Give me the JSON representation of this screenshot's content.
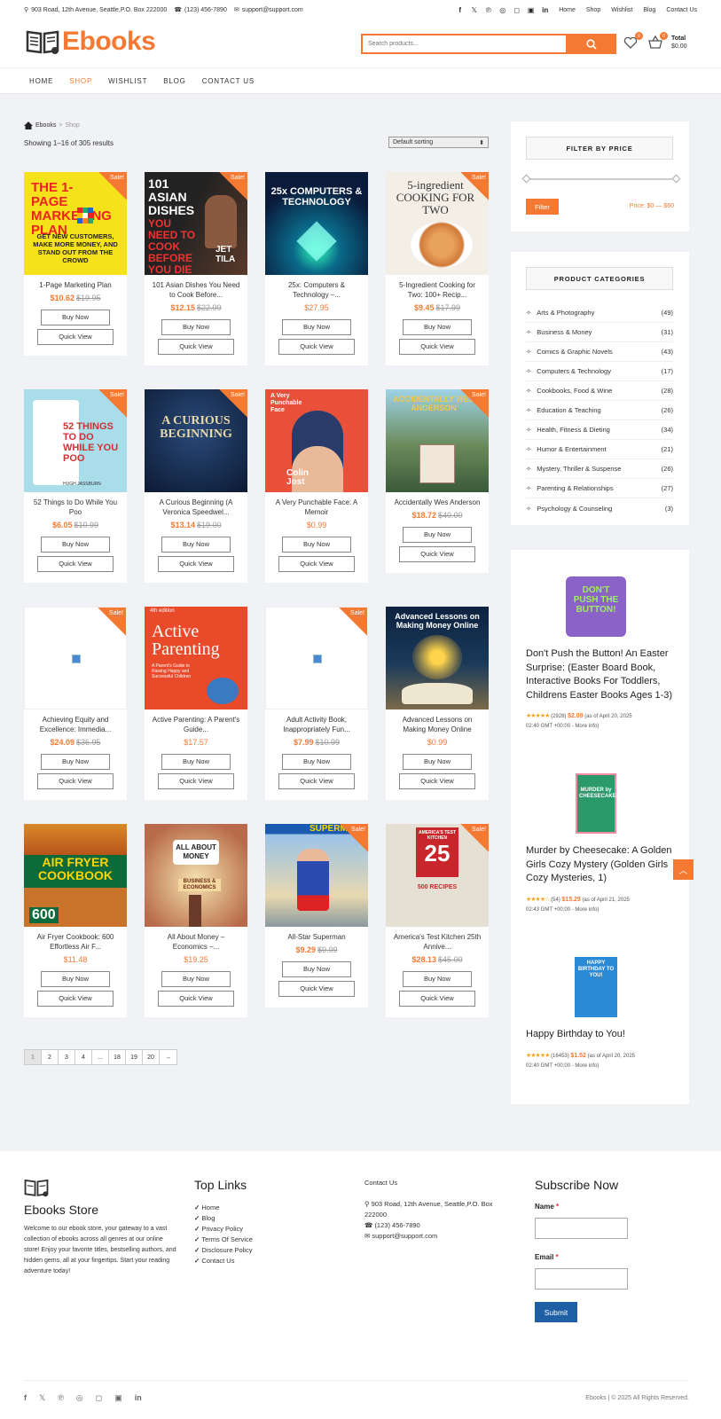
{
  "topbar": {
    "address": "903  Road, 12th Avenue, Seattle,P.O. Box 222000",
    "phone": "(123) 456-7890",
    "email": "support@support.com",
    "social_icons": [
      "facebook-icon",
      "x-icon",
      "pinterest-icon",
      "dribbble-icon",
      "instagram-icon",
      "flickr-icon",
      "linkedin-icon"
    ],
    "links": [
      "Home",
      "Shop",
      "Wishlist",
      "Blog",
      "Contact Us"
    ]
  },
  "header": {
    "logo_text": "Ebooks",
    "search_placeholder": "Search products...",
    "wishlist_count": "0",
    "cart_count": "0",
    "total_label": "Total",
    "total_value": "$0.00"
  },
  "nav": [
    "HOME",
    "SHOP",
    "WISHLIST",
    "BLOG",
    "CONTACT US"
  ],
  "breadcrumb": {
    "home": "Ebooks",
    "sep": ">",
    "current": "Shop"
  },
  "results_text": "Showing 1–16 of 305 results",
  "sort_selected": "Default sorting",
  "products": [
    {
      "title": "1-Page Marketing Plan",
      "price": "$10.62",
      "old": "$19.95",
      "sale": true
    },
    {
      "title": "101 Asian Dishes You Need to Cook Before...",
      "price": "$12.15",
      "old": "$22.99",
      "sale": true
    },
    {
      "title": "25x: Computers & Technology –...",
      "price": "$27.95",
      "old": "",
      "sale": false
    },
    {
      "title": "5-Ingredient Cooking for Two: 100+ Recip...",
      "price": "$9.45",
      "old": "$17.99",
      "sale": true
    },
    {
      "title": "52 Things to Do While You Poo",
      "price": "$6.05",
      "old": "$10.99",
      "sale": true
    },
    {
      "title": "A Curious Beginning (A Veronica Speedwel...",
      "price": "$13.14",
      "old": "$19.00",
      "sale": true
    },
    {
      "title": "A Very Punchable Face: A Memoir",
      "price": "$0.99",
      "old": "",
      "sale": false
    },
    {
      "title": "Accidentally Wes Anderson",
      "price": "$18.72",
      "old": "$40.00",
      "sale": true
    },
    {
      "title": "Achieving Equity and Excellence: Immedia...",
      "price": "$24.09",
      "old": "$36.95",
      "sale": true
    },
    {
      "title": "Active Parenting: A Parent's Guide...",
      "price": "$17.57",
      "old": "",
      "sale": false
    },
    {
      "title": "Adult Activity Book, Inappropriately Fun...",
      "price": "$7.99",
      "old": "$10.99",
      "sale": true
    },
    {
      "title": "Advanced Lessons on Making Money Online",
      "price": "$0.99",
      "old": "",
      "sale": false
    },
    {
      "title": "Air Fryer Cookbook: 600 Effortless Air F...",
      "price": "$11.48",
      "old": "",
      "sale": false
    },
    {
      "title": "All About Money – Economics –...",
      "price": "$19.25",
      "old": "",
      "sale": false
    },
    {
      "title": "All-Star Superman",
      "price": "$9.29",
      "old": "$9.99",
      "sale": true
    },
    {
      "title": "America's Test Kitchen 25th Annive...",
      "price": "$28.13",
      "old": "$45.00",
      "sale": true
    }
  ],
  "cover_text": {
    "p0": [
      "THE 1-PAGE MARKETING PLAN",
      "GET NEW CUSTOMERS, MAKE MORE MONEY, AND STAND OUT FROM THE CROWD"
    ],
    "p1": [
      "101 ASIAN DISHES",
      "YOU NEED TO COOK BEFORE YOU DIE",
      "JET TILA"
    ],
    "p2": [
      "25x COMPUTERS & TECHNOLOGY"
    ],
    "p3": [
      "5-ingredient COOKING FOR TWO"
    ],
    "p4": [
      "52 THINGS TO DO WHILE YOU POO",
      "HUGH JASSBURN"
    ],
    "p5": [
      "A CURIOUS BEGINNING"
    ],
    "p6": [
      "A Very Punchable Face",
      "Colin Jost"
    ],
    "p7": [
      "ACCIDENTALLY WES ANDERSON"
    ],
    "p9": [
      "4th edition",
      "Active Parenting",
      "A Parent's Guide to Raising Happy and Successful Children"
    ],
    "p11": [
      "Advanced Lessons on Making Money Online"
    ],
    "p12": [
      "AIR FRYER COOKBOOK",
      "600"
    ],
    "p13": [
      "ALL ABOUT MONEY",
      "BUSINESS & ECONOMICS"
    ],
    "p14": [
      "SUPERMAN"
    ],
    "p15": [
      "AMERICA'S TEST KITCHEN",
      "25",
      "500 RECIPES"
    ]
  },
  "buttons": {
    "buy": "Buy Now",
    "quick": "Quick View",
    "sale": "Sale!"
  },
  "pagination": [
    "1",
    "2",
    "3",
    "4",
    "...",
    "18",
    "19",
    "20",
    "→"
  ],
  "sidebar": {
    "filter_title": "FILTER BY PRICE",
    "filter_button": "Filter",
    "price_range": "Price: $0 — $60",
    "categories_title": "PRODUCT CATEGORIES",
    "categories": [
      {
        "name": "Arts & Photography",
        "count": "(49)"
      },
      {
        "name": "Business & Money",
        "count": "(31)"
      },
      {
        "name": "Comics & Graphic Novels",
        "count": "(43)"
      },
      {
        "name": "Computers & Technology",
        "count": "(17)"
      },
      {
        "name": "Cookbooks, Food & Wine",
        "count": "(28)"
      },
      {
        "name": "Education & Teaching",
        "count": "(26)"
      },
      {
        "name": "Health, Fitness & Dieting",
        "count": "(34)"
      },
      {
        "name": "Humor & Entertainment",
        "count": "(21)"
      },
      {
        "name": "Mystery, Thriller & Suspense",
        "count": "(26)"
      },
      {
        "name": "Parenting & Relationships",
        "count": "(27)"
      },
      {
        "name": "Psychology & Counseling",
        "count": "(3)"
      }
    ],
    "featured": [
      {
        "title": "Don't Push the Button! An Easter Surprise: (Easter Board Book, Interactive Books For Toddlers, Childrens Easter Books Ages 1-3)",
        "reviews": "(2928)",
        "price": "$2.09",
        "date": "(as of April 20, 2025",
        "time": "02:40 GMT +00:00 - More info)",
        "rating": 5,
        "cover": "DON'T PUSH THE BUTTON!"
      },
      {
        "title": "Murder by Cheesecake: A Golden Girls Cozy Mystery (Golden Girls Cozy Mysteries, 1)",
        "reviews": "(54)",
        "price": "$15.29",
        "date": "(as of April 21, 2025",
        "time": "02:43 GMT +00:00 - More info)",
        "rating": 4.5,
        "cover": "MURDER by CHEESECAKE"
      },
      {
        "title": "Happy Birthday to You!",
        "reviews": "(16453)",
        "price": "$1.52",
        "date": "(as of April 20, 2025",
        "time": "02:40 GMT +00:00 - More info)",
        "rating": 5,
        "cover": "HAPPY BIRTHDAY TO YOU!"
      }
    ]
  },
  "footer": {
    "store_title": "Ebooks Store",
    "about": "Welcome to our ebook store, your gateway to a vast collection of ebooks across all genres at our online store! Enjoy your favorite titles, bestselling authors, and hidden gems, all at your fingertips. Start your reading adventure today!",
    "links_title": "Top Links",
    "links": [
      "Home",
      "Blog",
      "Privacy Policy",
      "Terms Of Service",
      "Disclosure Policy",
      "Contact Us"
    ],
    "contact_title": "Contact Us",
    "contact_address": "903  Road, 12th Avenue, Seattle,P.O. Box 222000",
    "contact_phone": "(123) 456-7890",
    "contact_email": "support@support.com",
    "subscribe_title": "Subscribe Now",
    "name_label": "Name",
    "email_label": "Email",
    "required": "*",
    "submit": "Submit",
    "copyright": "Ebooks | © 2025 All Rights Reserved."
  },
  "colors": {
    "accent": "#f47a33",
    "submit": "#1f5fa5",
    "page_bg": "#f1f2f6"
  }
}
